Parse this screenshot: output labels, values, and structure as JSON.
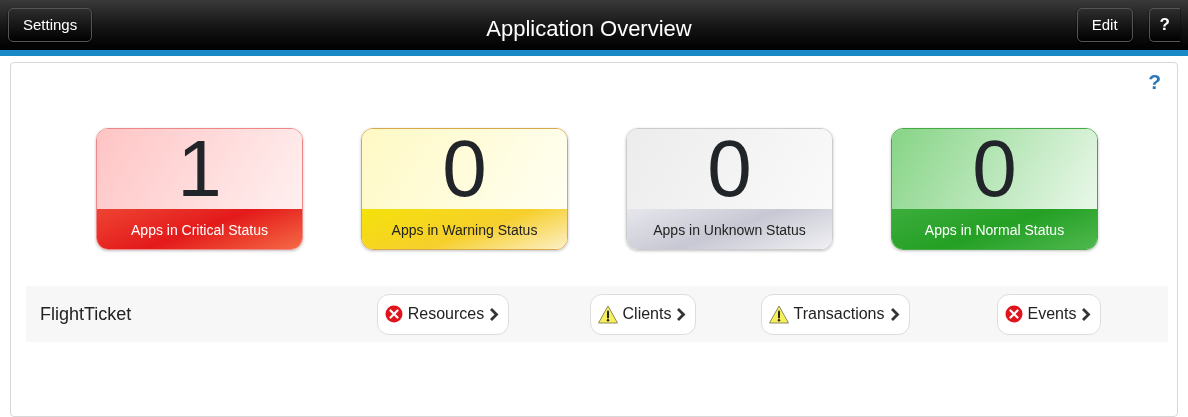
{
  "header": {
    "title": "Application Overview",
    "left_button": "Settings",
    "right_buttons": [
      "Edit",
      "?"
    ]
  },
  "panel": {
    "help": "?",
    "summary": [
      {
        "kind": "critical",
        "count": "1",
        "label": "Apps in Critical Status"
      },
      {
        "kind": "warning",
        "count": "0",
        "label": "Apps in Warning Status"
      },
      {
        "kind": "unknown",
        "count": "0",
        "label": "Apps in Unknown Status"
      },
      {
        "kind": "normal",
        "count": "0",
        "label": "Apps in Normal Status"
      }
    ],
    "apps": [
      {
        "name": "FlightTicket",
        "checks": [
          {
            "kind": "error",
            "label": "Resources"
          },
          {
            "kind": "warning",
            "label": "Clients"
          },
          {
            "kind": "warning",
            "label": "Transactions"
          },
          {
            "kind": "error",
            "label": "Events"
          }
        ]
      }
    ]
  }
}
